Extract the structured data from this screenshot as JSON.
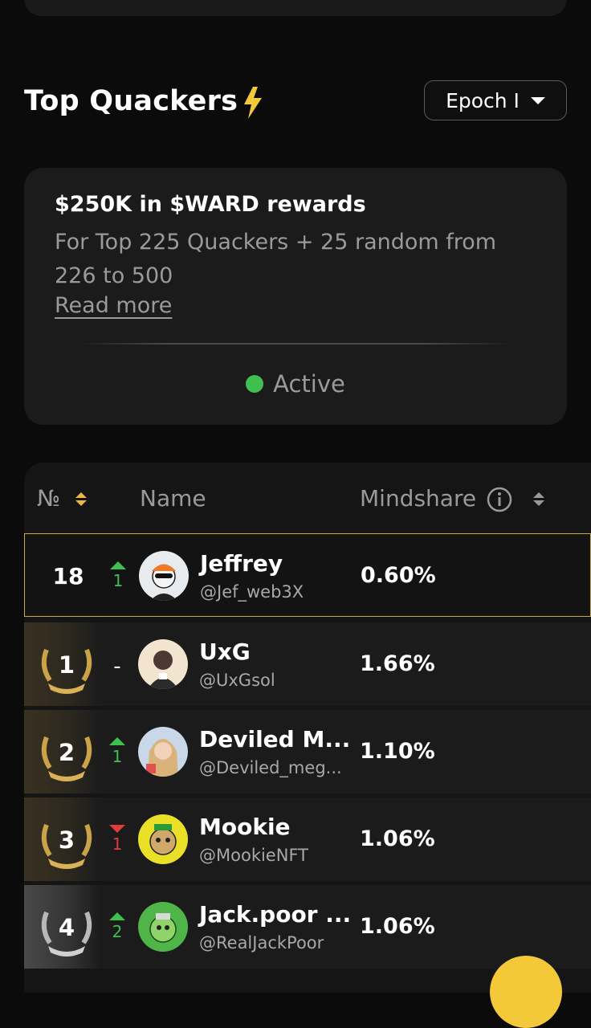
{
  "header": {
    "title": "Top Quackers",
    "epoch_label": "Epoch I"
  },
  "reward": {
    "title": "$250K in $WARD rewards",
    "description": "For Top 225 Quackers + 25 random from 226 to 500",
    "read_more": "Read more",
    "status": "Active",
    "status_color": "#3fbf4f"
  },
  "table": {
    "col_rank": "№",
    "col_name": "Name",
    "col_mindshare": "Mindshare",
    "rows": [
      {
        "rank": "18",
        "change": "1",
        "direction": "up",
        "name": "Jeffrey",
        "handle": "@Jef_web3X",
        "mindshare": "0.60%"
      },
      {
        "rank": "1",
        "change": "-",
        "direction": "none",
        "name": "UxG",
        "handle": "@UxGsol",
        "mindshare": "1.66%"
      },
      {
        "rank": "2",
        "change": "1",
        "direction": "up",
        "name": "Deviled M...",
        "handle": "@Deviled_meg...",
        "mindshare": "1.10%"
      },
      {
        "rank": "3",
        "change": "1",
        "direction": "down",
        "name": "Mookie",
        "handle": "@MookieNFT",
        "mindshare": "1.06%"
      },
      {
        "rank": "4",
        "change": "2",
        "direction": "up",
        "name": "Jack.poor ...",
        "handle": "@RealJackPoor",
        "mindshare": "1.06%"
      }
    ]
  },
  "colors": {
    "accent_gold": "#e8b84a",
    "up": "#3fbf4f",
    "down": "#e23b3b"
  }
}
